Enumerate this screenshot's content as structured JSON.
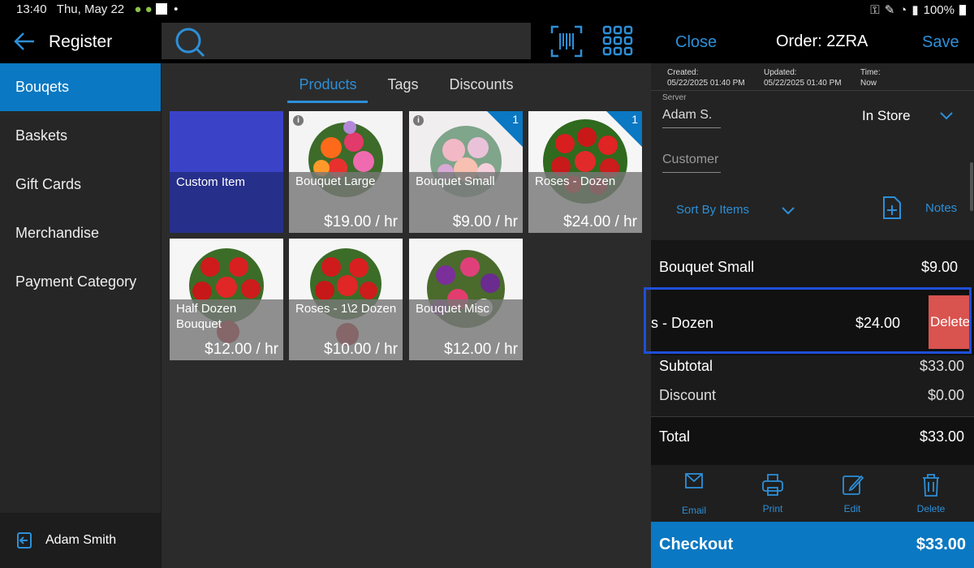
{
  "status": {
    "time": "13:40",
    "date": "Thu, May 22",
    "battery": "100%"
  },
  "header": {
    "title": "Register",
    "close": "Close",
    "order": "Order: 2ZRA",
    "save": "Save"
  },
  "sidebar": {
    "items": [
      {
        "label": "Bouqets"
      },
      {
        "label": "Baskets"
      },
      {
        "label": "Gift Cards"
      },
      {
        "label": "Merchandise"
      },
      {
        "label": "Payment Category"
      }
    ],
    "user": "Adam Smith"
  },
  "tabs": [
    "Products",
    "Tags",
    "Discounts"
  ],
  "products": [
    {
      "name": "Custom Item",
      "price": "",
      "badge": ""
    },
    {
      "name": "Bouquet Large",
      "price": "$19.00 / hr",
      "badge": ""
    },
    {
      "name": "Bouquet Small",
      "price": "$9.00 / hr",
      "badge": "1"
    },
    {
      "name": "Roses - Dozen",
      "price": "$24.00 / hr",
      "badge": "1"
    },
    {
      "name": "Half Dozen Bouquet",
      "price": "$12.00 / hr",
      "badge": ""
    },
    {
      "name": "Roses - 1\\2 Dozen",
      "price": "$10.00 / hr",
      "badge": ""
    },
    {
      "name": "Bouquet Misc",
      "price": "$12.00 / hr",
      "badge": ""
    }
  ],
  "order": {
    "created_label": "Created:",
    "created": "05/22/2025 01:40 PM",
    "updated_label": "Updated:",
    "updated": "05/22/2025 01:40 PM",
    "time_label": "Time:",
    "time": "Now",
    "server_label": "Server",
    "server": "Adam S.",
    "mode": "In Store",
    "customer_placeholder": "Customer",
    "sort": "Sort By Items",
    "notes": "Notes",
    "lines": [
      {
        "name": "Bouquet Small",
        "price": "$9.00"
      },
      {
        "name": "s - Dozen",
        "price": "$24.00",
        "action": "Delete"
      }
    ],
    "subtotal_label": "Subtotal",
    "subtotal": "$33.00",
    "discount_label": "Discount",
    "discount": "$0.00",
    "total_label": "Total",
    "total": "$33.00",
    "actions": [
      "Email",
      "Print",
      "Edit",
      "Delete"
    ],
    "checkout_label": "Checkout",
    "checkout_total": "$33.00"
  },
  "colors": {
    "accent": "#0a78c2",
    "link": "#2d8fd8",
    "delete": "#d9534f",
    "highlight": "#1f4fd8"
  }
}
